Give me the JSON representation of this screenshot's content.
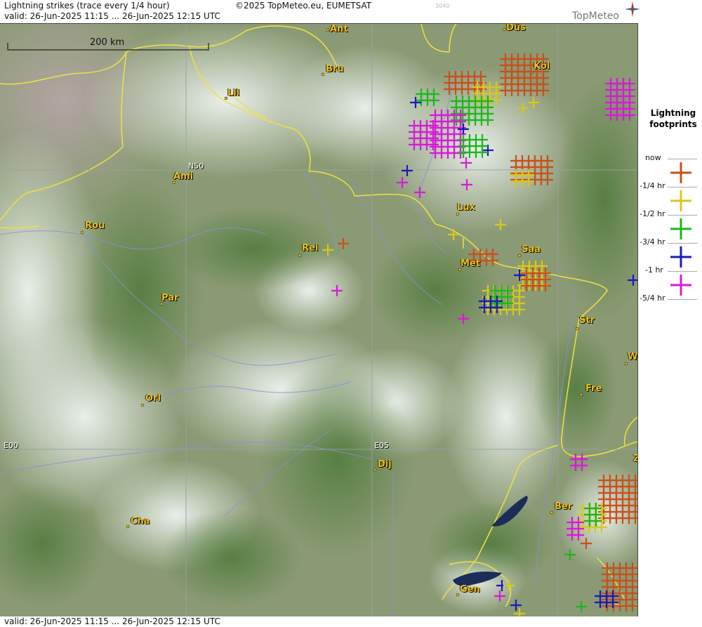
{
  "header": {
    "title": "Lightning strikes (trace every 1/4 hour)",
    "valid": "valid:  26-Jun-2025 11:15 ... 26-Jun-2025 12:15 UTC",
    "copyright": "©2025 TopMeteo.eu, EUMETSAT",
    "image_number": "3040",
    "brand": "TopMeteo"
  },
  "map": {
    "scale_label": "200 km",
    "grid_labels": {
      "lat": "N50",
      "lon0": "E00",
      "lon5": "E05"
    },
    "cities": [
      "Ant",
      "Düs",
      "Bru",
      "Köl",
      "Lil",
      "Ami",
      "Rou",
      "Lux",
      "Rei",
      "Saa",
      "Met",
      "Par",
      "Str",
      "Wi",
      "Fre",
      "Orl",
      "Dij",
      "Ber",
      "Cha",
      "Gen",
      "Z"
    ]
  },
  "footer": {
    "valid": "valid:  26-Jun-2025 11:15 ... 26-Jun-2025 12:15 UTC"
  },
  "legend": {
    "title": "Lightning footprints",
    "items": [
      {
        "label": "now",
        "color": "#c8501a"
      },
      {
        "label": "-1/4 hr",
        "color": "#d8c81a"
      },
      {
        "label": "-1/2 hr",
        "color": "#1ab81a"
      },
      {
        "label": "-3/4 hr",
        "color": "#1a1ab8"
      },
      {
        "label": "-1 hr",
        "color": "#d81ad8"
      },
      {
        "label": "-5/4 hr",
        "color": ""
      }
    ]
  }
}
